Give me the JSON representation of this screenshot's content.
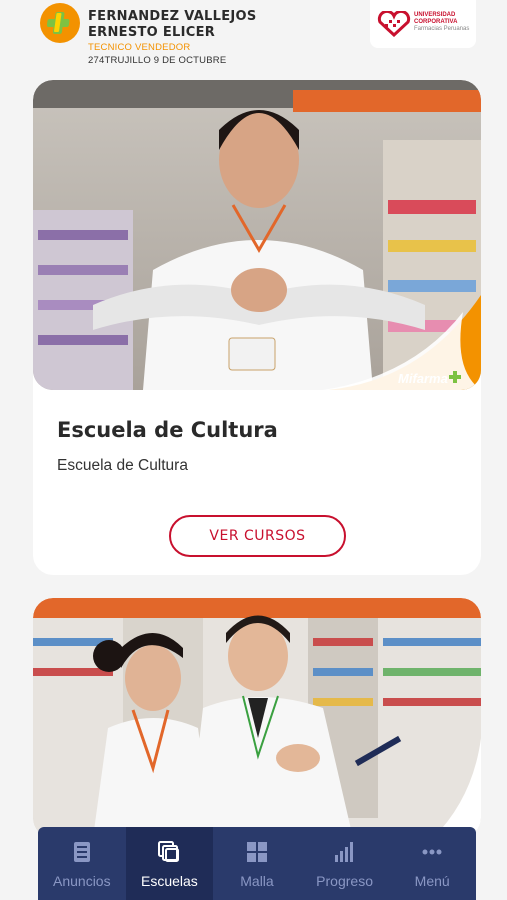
{
  "header": {
    "user_name_line1": "FERNANDEZ VALLEJOS",
    "user_name_line2": "ERNESTO ELICER",
    "role": "TECNICO VENDEDOR",
    "branch": "274TRUJILLO 9 DE OCTUBRE",
    "logo_icon": "cross-plus-icon",
    "university_line1": "UNIVERSIDAD",
    "university_line2": "CORPORATIVA",
    "university_line3": "Farmacias Peruanas"
  },
  "cards": [
    {
      "title": "Escuela de Cultura",
      "subtitle": "Escuela de Cultura",
      "button_label": "VER CURSOS",
      "brand_tag": "Mifarma"
    },
    {
      "title": "",
      "subtitle": "",
      "button_label": ""
    }
  ],
  "nav": {
    "items": [
      {
        "label": "Anuncios",
        "icon": "document-icon",
        "active": false
      },
      {
        "label": "Escuelas",
        "icon": "stacked-pages-icon",
        "active": true
      },
      {
        "label": "Malla",
        "icon": "grid-icon",
        "active": false
      },
      {
        "label": "Progreso",
        "icon": "bar-chart-icon",
        "active": false
      },
      {
        "label": "Menú",
        "icon": "more-dots-icon",
        "active": false
      }
    ]
  },
  "colors": {
    "brand_orange": "#f39200",
    "brand_red": "#c8102e",
    "nav_bg": "#2a3a6b",
    "nav_active": "#1f2c57"
  }
}
